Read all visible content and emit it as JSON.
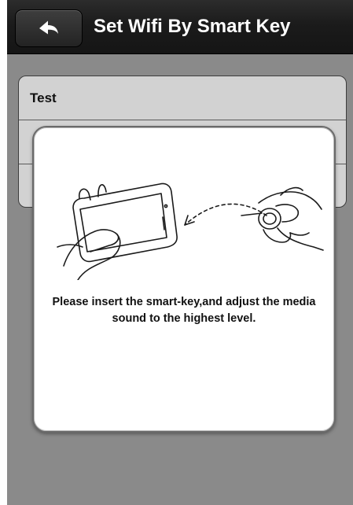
{
  "navbar": {
    "title": "Set Wifi By Smart Key",
    "back_icon": "back-arrow-icon"
  },
  "list": {
    "rows": [
      {
        "label": "Test"
      },
      {
        "label": ""
      },
      {
        "label": ""
      }
    ]
  },
  "dialog": {
    "illustration": "smart-key-insertion-illustration",
    "message": "Please insert the smart-key,and adjust the media sound to the highest level."
  },
  "colors": {
    "navbar": "#1b1b1b",
    "overlay": "#8a8a8a",
    "dialog_bg": "#ffffff",
    "text": "#111111"
  }
}
